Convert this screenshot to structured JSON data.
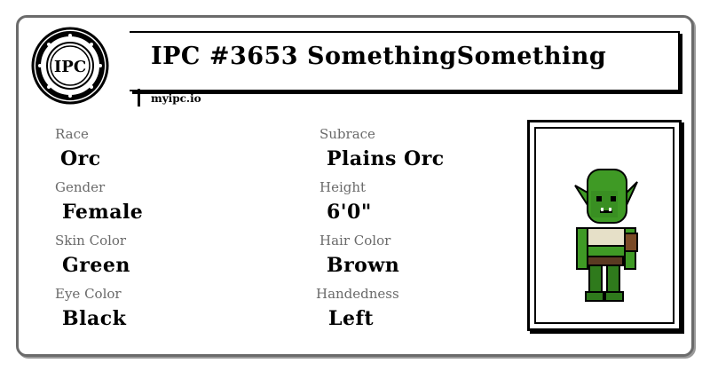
{
  "header": {
    "logo_text": "IPC",
    "title": "IPC #3653 SomethingSomething",
    "site": "myipc.io"
  },
  "fields": {
    "race": {
      "label": "Race",
      "value": "Orc"
    },
    "subrace": {
      "label": "Subrace",
      "value": "Plains Orc"
    },
    "gender": {
      "label": "Gender",
      "value": "Female"
    },
    "height": {
      "label": "Height",
      "value": "6'0\""
    },
    "skin_color": {
      "label": "Skin Color",
      "value": "Green"
    },
    "hair_color": {
      "label": "Hair Color",
      "value": "Brown"
    },
    "eye_color": {
      "label": "Eye Color",
      "value": "Black"
    },
    "handedness": {
      "label": "Handedness",
      "value": "Left"
    }
  },
  "portrait": {
    "icon": "orc-character-sprite"
  }
}
